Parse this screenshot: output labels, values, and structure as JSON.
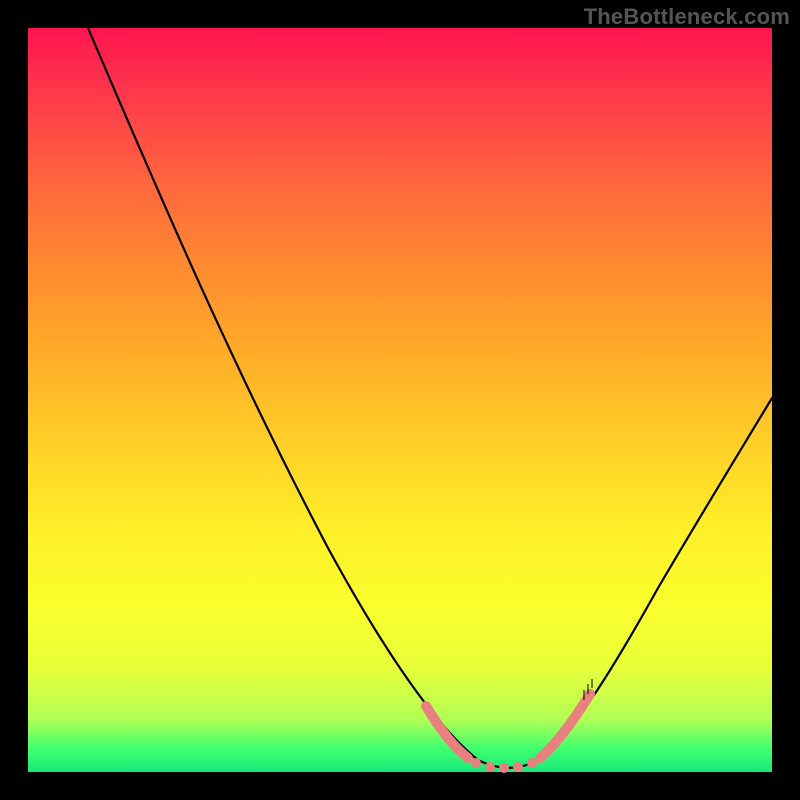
{
  "watermark": "TheBottleneck.com",
  "chart_data": {
    "type": "line",
    "title": "",
    "xlabel": "",
    "ylabel": "",
    "xlim": [
      0,
      100
    ],
    "ylim": [
      0,
      100
    ],
    "series": [
      {
        "name": "bottleneck-curve",
        "x": [
          8,
          14,
          20,
          26,
          32,
          38,
          44,
          50,
          56,
          58,
          60,
          62,
          64,
          66,
          68,
          70,
          72,
          78,
          84,
          90,
          96,
          100
        ],
        "values": [
          100,
          88,
          76,
          65,
          53,
          42,
          30,
          19,
          8,
          5,
          2.5,
          1,
          0.4,
          0.4,
          1,
          2.5,
          5,
          13,
          22,
          31,
          40,
          46
        ]
      }
    ],
    "salmon_segments": {
      "left": {
        "x": [
          56,
          58,
          60,
          62
        ],
        "values": [
          8,
          5,
          2.5,
          1
        ]
      },
      "flat": {
        "x": [
          62,
          64,
          66,
          68
        ],
        "values": [
          1,
          0.4,
          0.4,
          1
        ]
      },
      "right": {
        "x": [
          70,
          72,
          74,
          75
        ],
        "values": [
          2.5,
          5,
          8,
          10
        ]
      }
    },
    "colors": {
      "curve": "#000000",
      "salmon": "#e98080",
      "gradient_top": "#ff1450",
      "gradient_bottom": "#18e878"
    }
  }
}
